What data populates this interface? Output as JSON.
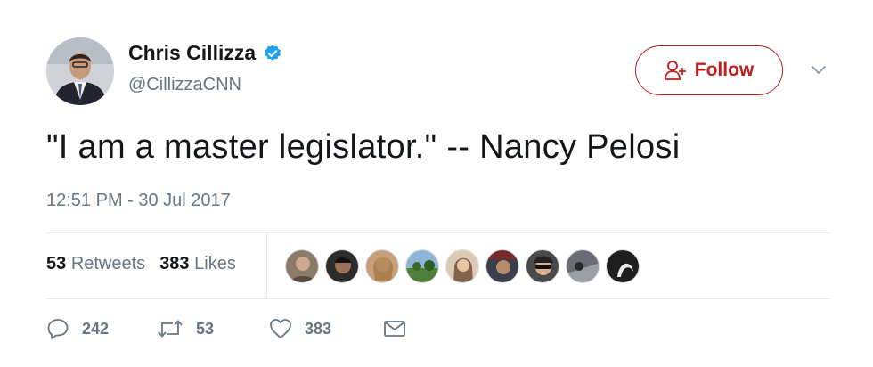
{
  "author": {
    "display_name": "Chris Cillizza",
    "handle": "@CillizzaCNN",
    "verified": true
  },
  "follow_button": {
    "label": "Follow",
    "accent_color": "#c51a1a"
  },
  "tweet": {
    "text": "\"I am a master legislator.\" -- Nancy Pelosi",
    "timestamp": "12:51 PM - 30 Jul 2017"
  },
  "stats": {
    "retweets": {
      "count": "53",
      "label": "Retweets"
    },
    "likes": {
      "count": "383",
      "label": "Likes"
    }
  },
  "liker_avatars": [
    {
      "icon": "liker-avatar-1"
    },
    {
      "icon": "liker-avatar-2"
    },
    {
      "icon": "liker-avatar-3"
    },
    {
      "icon": "liker-avatar-4"
    },
    {
      "icon": "liker-avatar-5"
    },
    {
      "icon": "liker-avatar-6"
    },
    {
      "icon": "liker-avatar-7"
    },
    {
      "icon": "liker-avatar-8"
    },
    {
      "icon": "liker-avatar-9"
    }
  ],
  "actions": {
    "reply_count": "242",
    "retweet_count": "53",
    "like_count": "383"
  },
  "colors": {
    "text": "#14171a",
    "muted": "#657786",
    "verified": "#1da1f2",
    "divider": "#e6ecf0"
  }
}
